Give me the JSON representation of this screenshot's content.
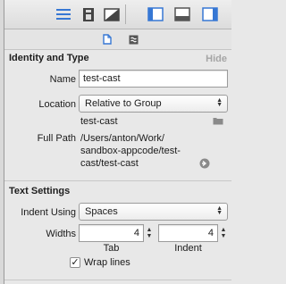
{
  "toolbar": {
    "icons": [
      "editor-standard-icon",
      "library-icon",
      "inspector-icon",
      "navigator-toggle-icon",
      "debug-area-toggle-icon",
      "utilities-toggle-icon"
    ]
  },
  "inspector_tabs": [
    "file-inspector-icon",
    "quick-help-icon"
  ],
  "identity_type": {
    "title": "Identity and Type",
    "hide_label": "Hide",
    "name_label": "Name",
    "name_value": "test-cast",
    "location_label": "Location",
    "location_value": "Relative to Group",
    "location_path": "test-cast",
    "full_path_label": "Full Path",
    "full_path_lines": [
      "/Users/anton/Work/",
      "sandbox-appcode/test-",
      "cast/test-cast"
    ]
  },
  "text_settings": {
    "title": "Text Settings",
    "indent_using_label": "Indent Using",
    "indent_using_value": "Spaces",
    "widths_label": "Widths",
    "tab_width": "4",
    "indent_width": "4",
    "tab_label": "Tab",
    "indent_label": "Indent",
    "wrap_lines_label": "Wrap lines",
    "wrap_lines_checked": true
  }
}
